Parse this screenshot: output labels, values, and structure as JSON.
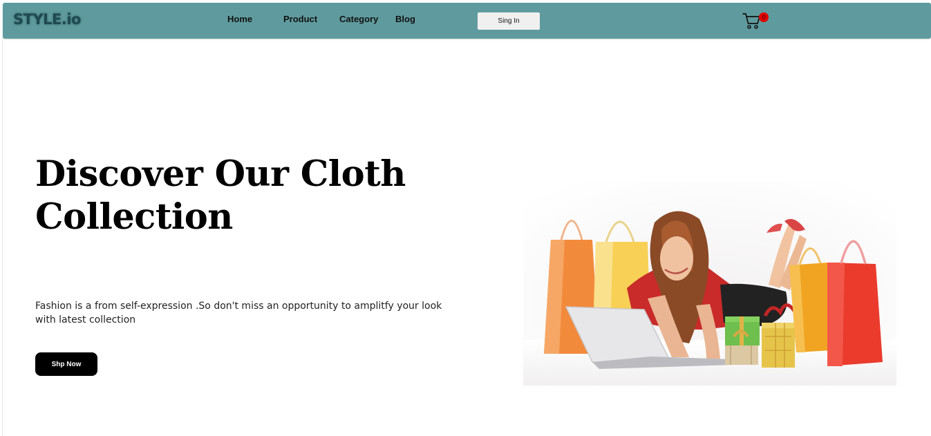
{
  "header": {
    "logo": "STYLE.io",
    "nav": [
      "Home",
      "Product",
      "Category",
      "Blog"
    ],
    "signin_label": "Sing In",
    "cart_count": "0"
  },
  "hero": {
    "title_line1": "Discover Our Cloth",
    "title_line2": "Collection",
    "description": "Fashion is a from self-expression .So don't miss an opportunity to amplitfy your look with latest collection",
    "cta_label": "Shp Now"
  },
  "colors": {
    "navbar": "#5f9b9e",
    "logo": "#1f4a52",
    "badge": "#e00000",
    "cta": "#000000"
  },
  "icons": [
    "cart-icon"
  ]
}
